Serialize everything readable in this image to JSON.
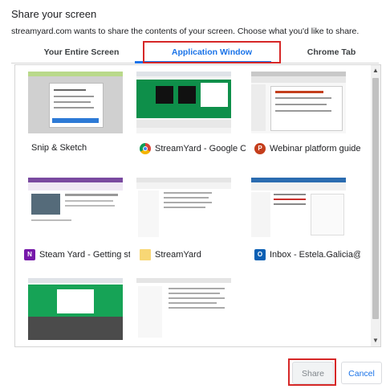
{
  "dialog": {
    "title": "Share your screen",
    "subtitle": "streamyard.com wants to share the contents of your screen. Choose what you'd like to share."
  },
  "tabs": [
    {
      "label": "Your Entire Screen",
      "selected": false
    },
    {
      "label": "Application Window",
      "selected": true
    },
    {
      "label": "Chrome Tab",
      "selected": false
    }
  ],
  "windows": [
    {
      "label": "Snip & Sketch",
      "icon": "snip-sketch-icon"
    },
    {
      "label": "StreamYard - Google Ch...",
      "icon": "chrome-icon"
    },
    {
      "label": "Webinar platform guide...",
      "icon": "powerpoint-icon"
    },
    {
      "label": "Steam Yard - Getting sta...",
      "icon": "onenote-icon"
    },
    {
      "label": "StreamYard",
      "icon": "folder-icon"
    },
    {
      "label": "Inbox - Estela.Galicia@i...",
      "icon": "outlook-icon"
    },
    {
      "label": "",
      "icon": ""
    },
    {
      "label": "",
      "icon": ""
    }
  ],
  "icon_letters": {
    "onenote": "N",
    "outlook": "O",
    "powerpoint": "P"
  },
  "buttons": {
    "share": "Share",
    "cancel": "Cancel"
  },
  "colors": {
    "accent": "#1a73e8",
    "highlight": "#d62828"
  }
}
